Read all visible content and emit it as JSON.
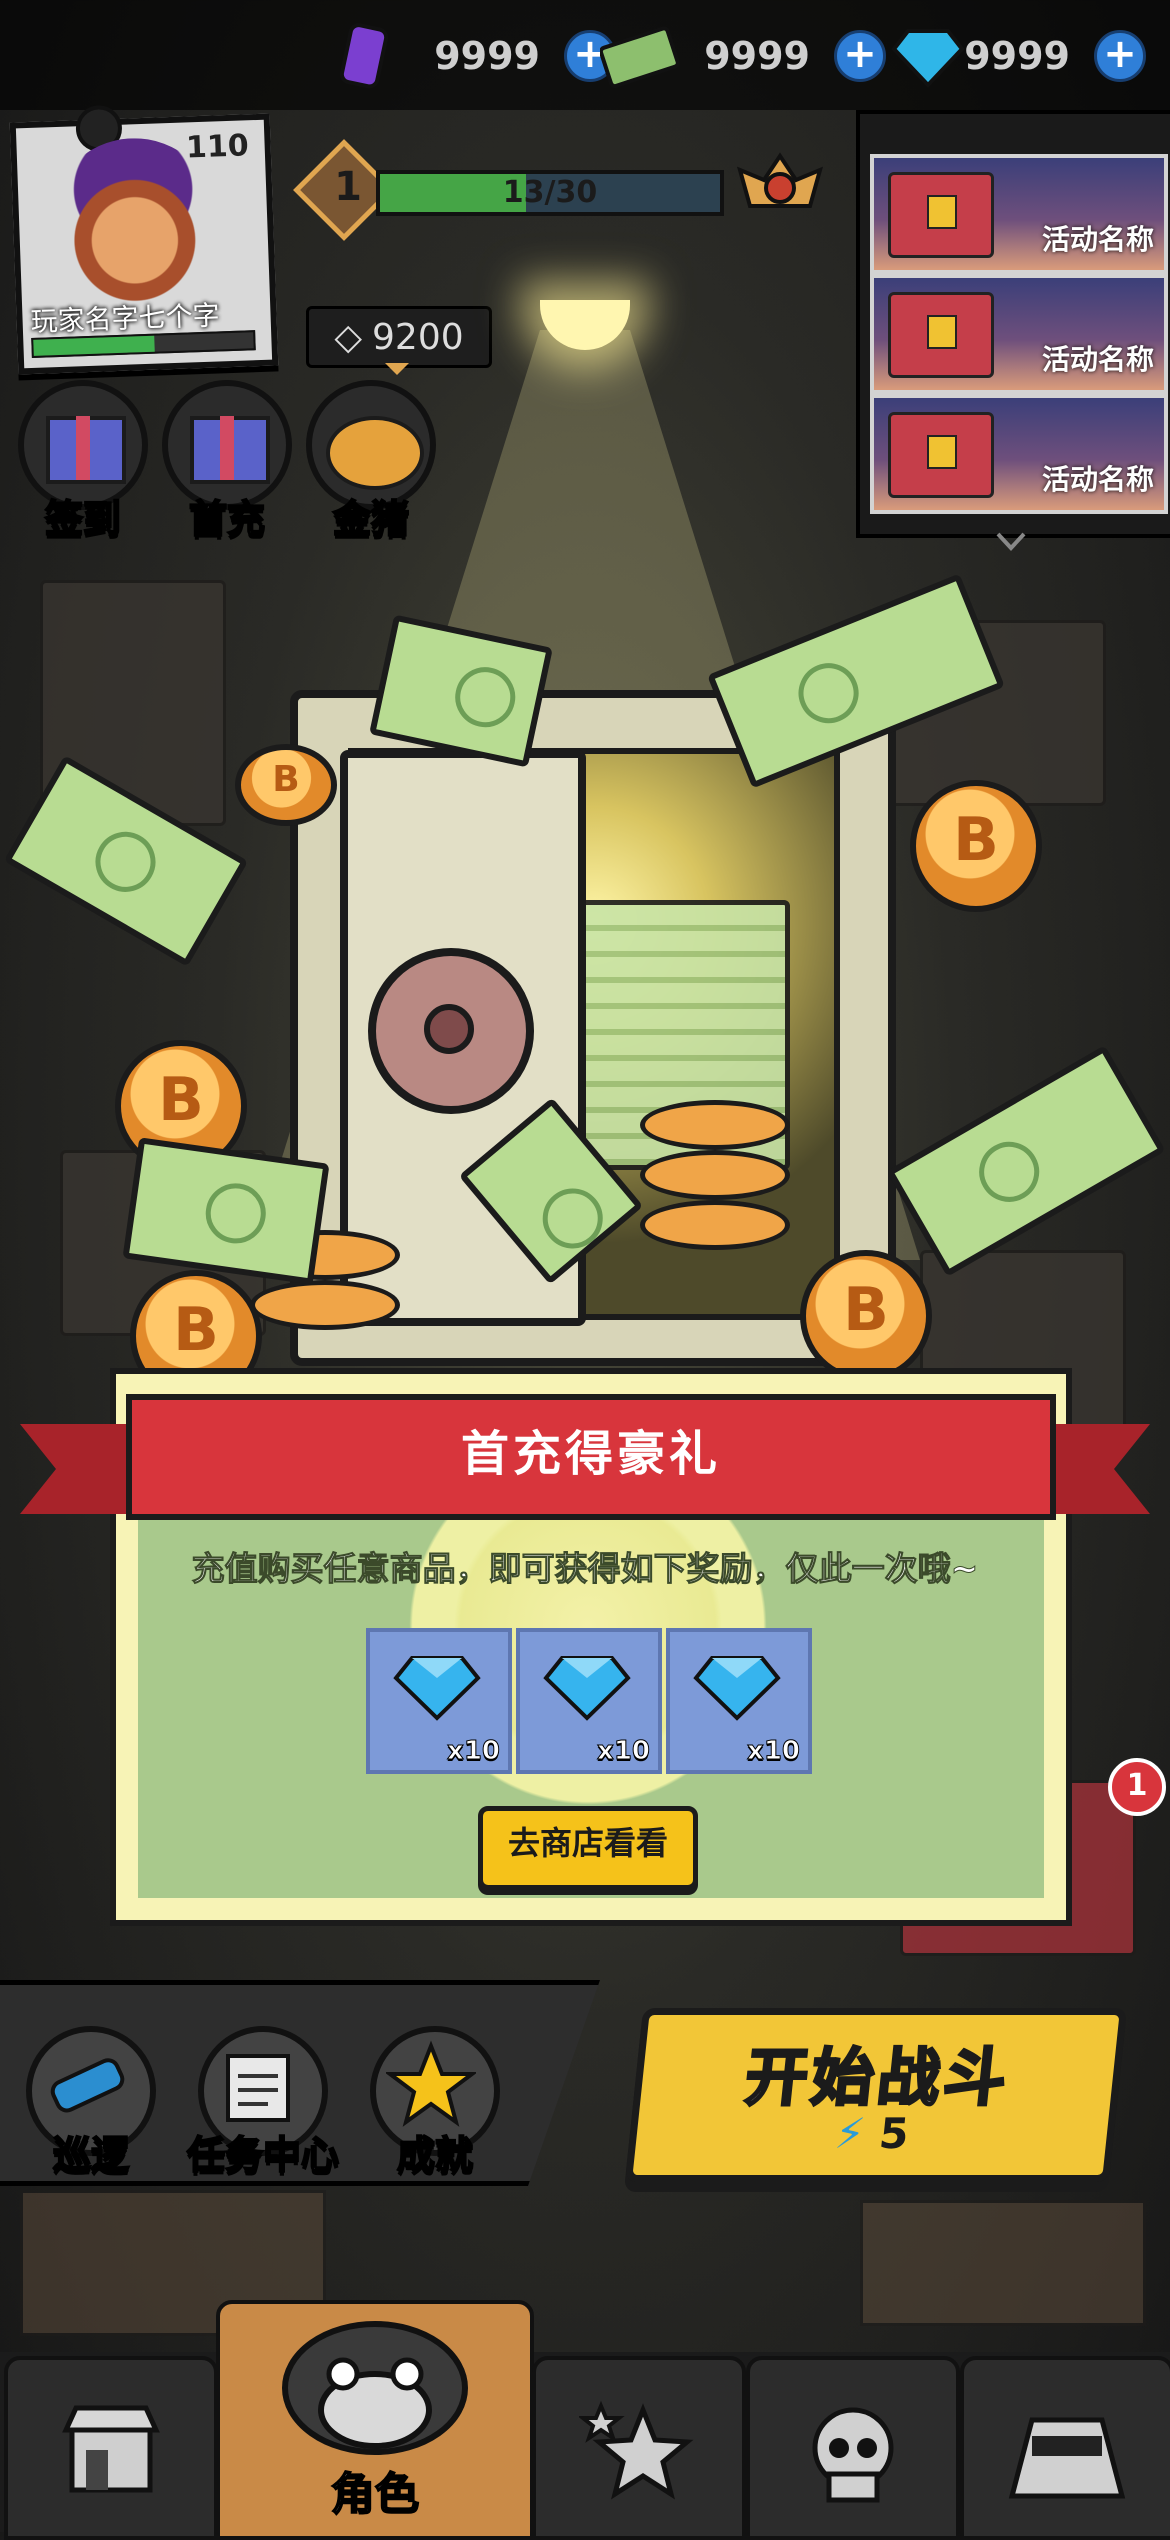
{
  "currencies": [
    {
      "name": "energy-drink",
      "value": "9999"
    },
    {
      "name": "cash",
      "value": "9999"
    },
    {
      "name": "diamond",
      "value": "9999"
    }
  ],
  "player": {
    "level": "110",
    "name": "玩家名字七个字"
  },
  "rank": {
    "level": "1",
    "progress_text": "13/30",
    "progress": 0.43
  },
  "gem_counter": "9200",
  "quick_actions": [
    {
      "label": "签到",
      "icon": "gift-icon"
    },
    {
      "label": "首充",
      "icon": "gift-icon"
    },
    {
      "label": "金猪",
      "icon": "piggy-bank-icon"
    }
  ],
  "events": [
    {
      "label": "活动名称"
    },
    {
      "label": "活动名称"
    },
    {
      "label": "活动名称"
    }
  ],
  "popup": {
    "title": "首充得豪礼",
    "description": "充值购买任意商品，即可获得如下奖励，仅此一次哦~",
    "rewards": [
      {
        "icon": "diamond-icon",
        "qty": "x10"
      },
      {
        "icon": "diamond-icon",
        "qty": "x10"
      },
      {
        "icon": "diamond-icon",
        "qty": "x10"
      }
    ],
    "button": "去商店看看"
  },
  "notification_badge": "1",
  "bottom_actions": [
    {
      "label": "巡逻",
      "icon": "telescope-icon"
    },
    {
      "label": "任务中心",
      "icon": "newspaper-icon"
    },
    {
      "label": "成就",
      "icon": "star-icon"
    }
  ],
  "battle": {
    "title": "开始战斗",
    "cost": "5"
  },
  "tabs": [
    {
      "label": "",
      "icon": "shop-icon"
    },
    {
      "label": "角色",
      "icon": "gorilla-icon"
    },
    {
      "label": "",
      "icon": "star-icon"
    },
    {
      "label": "",
      "icon": "skull-icon"
    },
    {
      "label": "",
      "icon": "masked-character-icon"
    }
  ],
  "colors": {
    "accent_yellow": "#f5c21a",
    "ribbon_red": "#d8353c",
    "progress_green": "#45a546",
    "plus_blue": "#2f7fd8"
  }
}
